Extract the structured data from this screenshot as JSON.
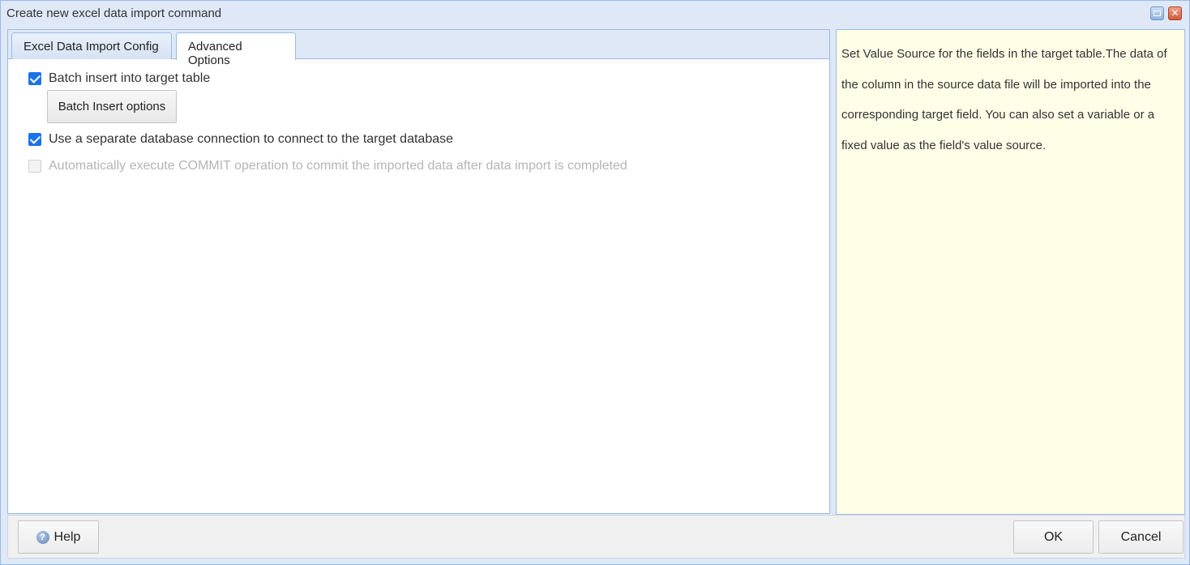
{
  "window": {
    "title": "Create new excel data import command"
  },
  "tabs": [
    {
      "label": "Excel Data Import Config",
      "active": false
    },
    {
      "label": "Advanced Options",
      "active": true
    }
  ],
  "options": {
    "batch_insert": {
      "label": "Batch insert into target table",
      "checked": true
    },
    "batch_insert_button": "Batch Insert options",
    "separate_connection": {
      "label": "Use a separate database connection to connect to the target database",
      "checked": true
    },
    "auto_commit": {
      "label": "Automatically execute COMMIT operation to commit the imported data after data import is completed",
      "checked": false,
      "disabled": true
    }
  },
  "help_panel": {
    "text": "Set Value Source for the fields in the target table.The data of the column in the source data file will be imported into the corresponding target field. You can also set a variable or a fixed value as the field's value source."
  },
  "footer": {
    "help_label": "Help",
    "ok_label": "OK",
    "cancel_label": "Cancel"
  },
  "colors": {
    "accent": "#1a73e8",
    "frame": "#dfe8f6",
    "border": "#99bbe8",
    "help_bg": "#ffffe8"
  }
}
